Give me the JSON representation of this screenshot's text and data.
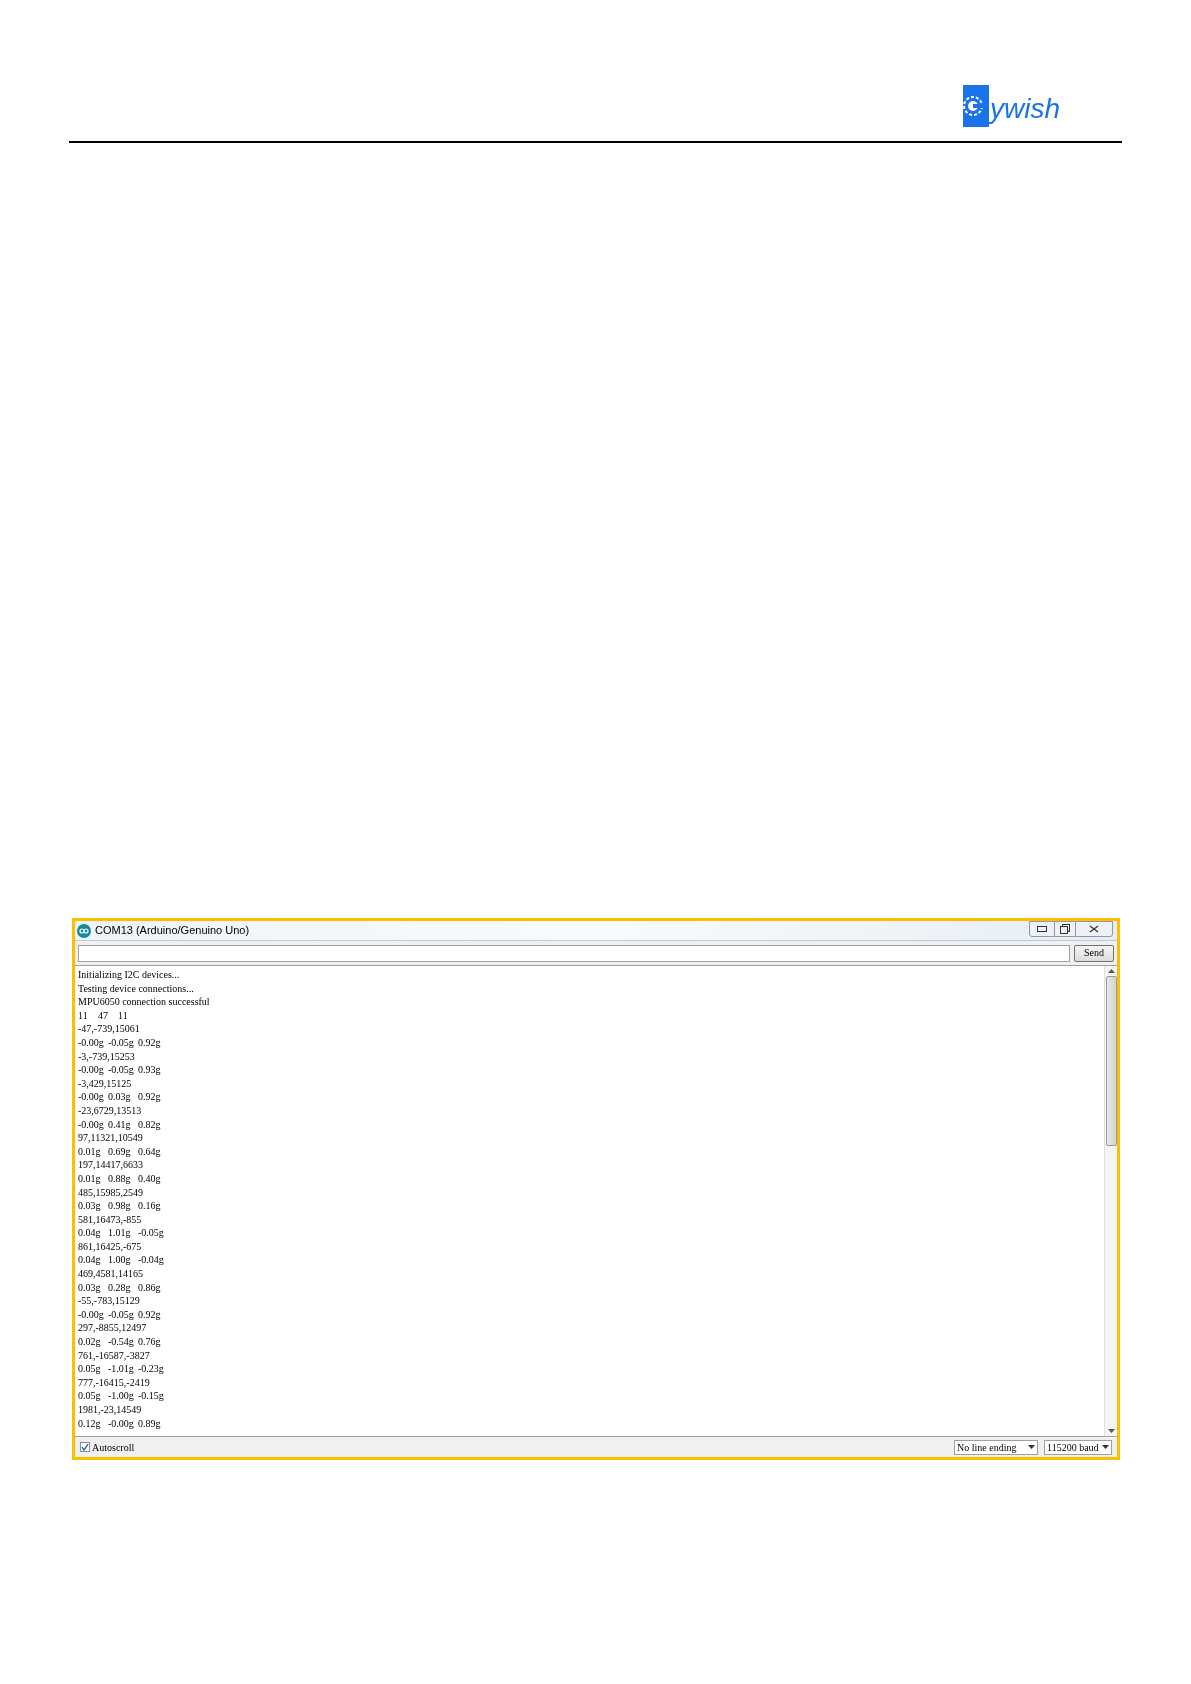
{
  "logo": {
    "text": "ywish"
  },
  "window": {
    "title": "COM13 (Arduino/Genuino Uno)"
  },
  "send_button": "Send",
  "output_lines": [
    "Initializing I2C devices...",
    "Testing device connections...",
    "MPU6050 connection successful",
    "11\t47\t11",
    "-47,-739,15061",
    "-0.00g\t-0.05g\t0.92g",
    "-3,-739,15253",
    "-0.00g\t-0.05g\t0.93g",
    "-3,429,15125",
    "-0.00g\t0.03g\t0.92g",
    "-23,6729,13513",
    "-0.00g\t0.41g\t0.82g",
    "97,11321,10549",
    "0.01g\t0.69g\t0.64g",
    "197,14417,6633",
    "0.01g\t0.88g\t0.40g",
    "485,15985,2549",
    "0.03g\t0.98g\t0.16g",
    "581,16473,-855",
    "0.04g\t1.01g\t-0.05g",
    "861,16425,-675",
    "0.04g\t1.00g\t-0.04g",
    "469,4581,14165",
    "0.03g\t0.28g\t0.86g",
    "-55,-783,15129",
    "-0.00g\t-0.05g\t0.92g",
    "297,-8855,12497",
    "0.02g\t-0.54g\t0.76g",
    "761,-16587,-3827",
    "0.05g\t-1.01g\t-0.23g",
    "777,-16415,-2419",
    "0.05g\t-1.00g\t-0.15g",
    "1981,-23,14549",
    "0.12g\t-0.00g\t0.89g"
  ],
  "autoscroll": {
    "label": "Autoscroll",
    "checked": true
  },
  "line_ending": "No line ending",
  "baud_rate": "115200 baud"
}
